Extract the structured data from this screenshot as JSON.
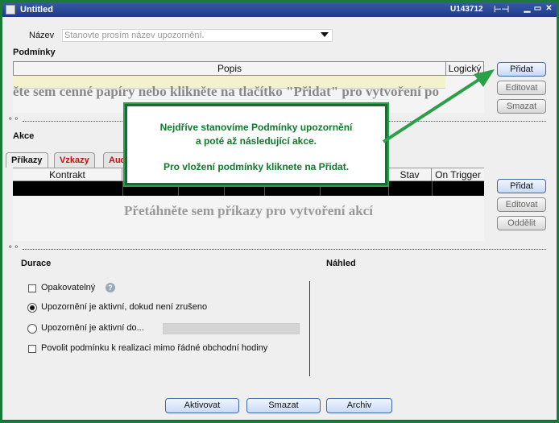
{
  "window": {
    "title": "Untitled",
    "account": "U143712",
    "pin_icon": "pin-icon",
    "minimize_icon": "minimize-icon",
    "maximize_icon": "maximize-icon",
    "close_icon": "close-icon"
  },
  "name_row": {
    "label": "Název",
    "placeholder": "Stanovte prosím název upozornění."
  },
  "conditions": {
    "heading": "Podmínky",
    "columns": [
      "Popis",
      "Logický"
    ],
    "hint": "ěte sem cenné papíry nebo klikněte na tlačítko \"Přidat\" pro vytvoření po",
    "buttons": {
      "add": "Přidat",
      "edit": "Editovat",
      "delete": "Smazat"
    }
  },
  "actions": {
    "heading": "Akce",
    "tabs": [
      "Příkazy",
      "Vzkazy",
      "Aud"
    ],
    "columns": [
      "Kontrakt",
      "Stav",
      "On Trigger"
    ],
    "hint": "Přetáhněte sem příkazy pro vytvoření akcí",
    "buttons": {
      "add": "Přidat",
      "edit": "Editovat",
      "separate": "Oddělit"
    }
  },
  "callout": {
    "line1": "Nejdříve stanovíme Podmínky upozornění",
    "line2": "a poté až následující akce.",
    "line3": "Pro vložení podmínky kliknete na Přidat."
  },
  "duration": {
    "heading": "Durace",
    "repeat": "Opakovatelný",
    "active_until_cancel": "Upozornění je aktivní, dokud není zrušeno",
    "active_until_date": "Upozornění je aktivní do...",
    "allow_outside_hours": "Povolit podmínku k realizaci mimo řádné obchodní hodiny",
    "selected": "active_until_cancel"
  },
  "preview": {
    "heading": "Náhled"
  },
  "footer": {
    "activate": "Aktivovat",
    "delete": "Smazat",
    "archive": "Archiv"
  },
  "colors": {
    "callout_border": "#2aa048",
    "callout_text": "#0e7a2a",
    "frame": "#1a7a3a",
    "title_bar": "#2a4a98",
    "tab_inactive_text": "#c01010",
    "condition_row": "#f4f2cc"
  }
}
